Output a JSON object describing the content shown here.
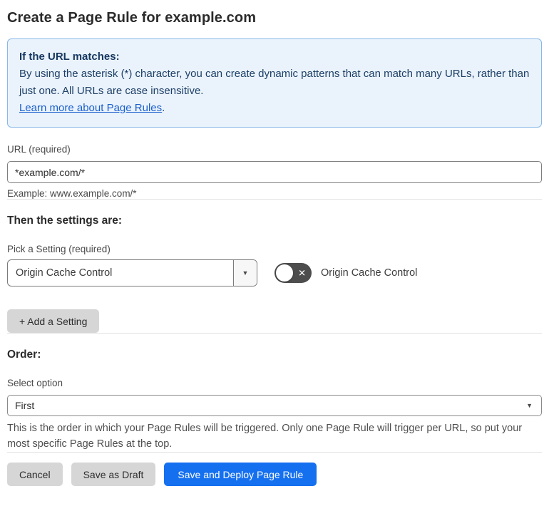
{
  "page": {
    "title": "Create a Page Rule for example.com"
  },
  "info_box": {
    "heading": "If the URL matches:",
    "body": "By using the asterisk (*) character, you can create dynamic patterns that can match many URLs, rather than just one. All URLs are case insensitive.",
    "link_label": "Learn more about Page Rules",
    "link_suffix": "."
  },
  "url_field": {
    "label": "URL (required)",
    "value": "*example.com/*",
    "helper": "Example: www.example.com/*"
  },
  "settings": {
    "heading": "Then the settings are:",
    "picker_label": "Pick a Setting (required)",
    "selected_setting": "Origin Cache Control",
    "toggle_label": "Origin Cache Control",
    "toggle_state": "off",
    "add_button_label": "+ Add a Setting"
  },
  "order": {
    "heading": "Order:",
    "select_label": "Select option",
    "selected_option": "First",
    "helper": "This is the order in which your Page Rules will be triggered. Only one Page Rule will trigger per URL, so put your most specific Page Rules at the top."
  },
  "actions": {
    "cancel_label": "Cancel",
    "save_draft_label": "Save as Draft",
    "save_deploy_label": "Save and Deploy Page Rule"
  },
  "icons": {
    "dropdown_arrow": "▼",
    "toggle_x": "✕"
  },
  "colors": {
    "accent_blue": "#1570f0",
    "info_background": "#eaf3fc",
    "info_border": "#88b7e8",
    "info_text": "#1d3f66",
    "link_blue": "#1b5fcc",
    "toggle_off_background": "#4d4d4d",
    "button_gray": "#d6d6d6"
  }
}
